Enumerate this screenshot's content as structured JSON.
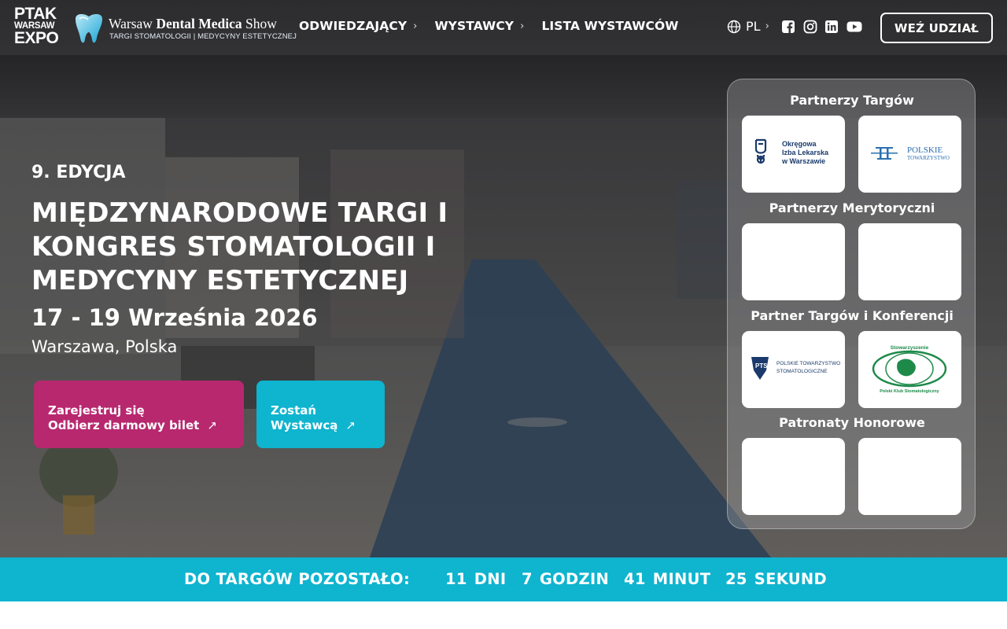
{
  "header": {
    "ptak_logo": [
      "PTAK",
      "WARSAW",
      "EXPO"
    ],
    "show_logo": {
      "title_prefix": "Warsaw ",
      "title_bold": "Dental Medica",
      "title_suffix": " Show",
      "subtitle": "TARGI STOMATOLOGII | MEDYCYNY ESTETYCZNEJ"
    },
    "nav": [
      {
        "label": "ODWIEDZAJĄCY",
        "has_submenu": true
      },
      {
        "label": "WYSTAWCY",
        "has_submenu": true
      },
      {
        "label": "LISTA WYSTAWCÓW",
        "has_submenu": false
      }
    ],
    "language": "PL",
    "social_icons": [
      "facebook-icon",
      "instagram-icon",
      "linkedin-icon",
      "youtube-icon"
    ],
    "cta": "WEŹ UDZIAŁ"
  },
  "hero": {
    "edition": "9. EDYCJA",
    "title": "MIĘDZYNARODOWE TARGI I KONGRES STOMATOLOGII I MEDYCYNY ESTETYCZNEJ",
    "dates": "17 - 19 Września 2026",
    "location": "Warszawa, Polska",
    "register_button": {
      "line1": "Zarejestruj się",
      "line2": "Odbierz darmowy bilet"
    },
    "exhibitor_button": {
      "line1": "Zostań",
      "line2": "Wystawcą"
    },
    "colors": {
      "register": "#b7286f",
      "exhibitor": "#0fb4cf"
    }
  },
  "partners": {
    "sections": [
      {
        "heading": "Partnerzy Targów",
        "logos": [
          {
            "name": "okregowa-izba-lekarska-logo",
            "text": [
              "Okręgowa",
              "Izba Lekarska",
              "w Warszawie"
            ]
          },
          {
            "name": "polskie-towarzystwo-logo",
            "text": [
              "POLSKIE",
              "TOWARZYSTWO"
            ]
          }
        ]
      },
      {
        "heading": "Partnerzy Merytoryczni",
        "logos": [
          {
            "name": "blank-logo-1",
            "text": []
          },
          {
            "name": "blank-logo-2",
            "text": []
          }
        ]
      },
      {
        "heading": "Partner Targów i Konferencji",
        "logos": [
          {
            "name": "pts-logo",
            "text": [
              "POLSKIE TOWARZYSTWO",
              "STOMATOLOGICZNE"
            ]
          },
          {
            "name": "polski-klub-stomatologiczny-logo",
            "text": [
              "Stowarzyszenie",
              "Polski Klub Stomatologiczny"
            ]
          }
        ]
      },
      {
        "heading": "Patronaty Honorowe",
        "logos": [
          {
            "name": "blank-logo-3",
            "text": []
          },
          {
            "name": "blank-logo-4",
            "text": []
          }
        ]
      }
    ]
  },
  "countdown": {
    "label": "DO TARGÓW POZOSTAŁO:",
    "units": [
      {
        "value": "11",
        "unit": "DNI"
      },
      {
        "value": "7",
        "unit": "GODZIN"
      },
      {
        "value": "41",
        "unit": "MINUT"
      },
      {
        "value": "25",
        "unit": "SEKUND"
      }
    ],
    "color": "#0fb4cf"
  }
}
